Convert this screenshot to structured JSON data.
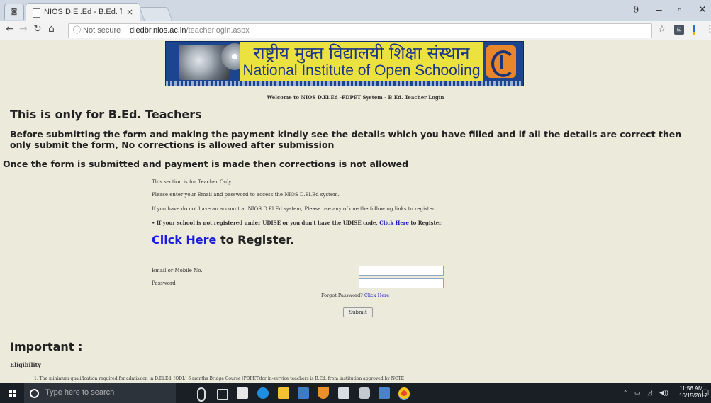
{
  "browser": {
    "tab_title": "NIOS D.El.Ed - B.Ed. Tea",
    "tab_close": "×",
    "security_label": "ⓘ Not secure",
    "url_host": "dledbr.nios.ac.in",
    "url_path": "/teacherlogin.aspx"
  },
  "banner": {
    "hindi_text": "राष्ट्रीय मुक्त विद्यालयी शिक्षा संस्थान",
    "english_text": "National Institute of Open Schooling"
  },
  "page": {
    "welcome": "Welcome to NIOS D.El.Ed -PDPET System - B.Ed. Teacher Login",
    "heading": "This is only for B.Ed. Teachers",
    "notice1": "Before submitting the form and making the payment kindly see the details which you have filled and if all the details are correct then only submit the form, No corrections is allowed after submission",
    "notice2": "Once the form is submitted and payment is made then corrections is not allowed",
    "line1": "This section is for Teacher Only.",
    "line2": "Please enter your Email and password to access the NIOS D.El.Ed system.",
    "line3": "If you have do not have an account at NIOS D.El.Ed system, Please use any of one the following links to register",
    "udise_text_before": "• If your school is not registered under UDISE or you don't have the UDISE code,",
    "udise_link": "Click Here",
    "udise_text_after": "to Register.",
    "register_link": "Click Here",
    "register_text": "to Register."
  },
  "form": {
    "email_label": "Email or Mobile No.",
    "email_value": "",
    "password_label": "Password",
    "password_value": "",
    "forgot_text": "Forgot Password?",
    "forgot_link": "Click Here",
    "submit_label": "Submit"
  },
  "important": {
    "heading": "Important :",
    "eligibility_heading": "Eligibility",
    "point1": "1. The minimum qualification required for admission in D.El.Ed. (ODL) 6 months Bridge Course (PDPET)for in-service teachers is B.Ed. from institution approved by NCTE"
  },
  "taskbar": {
    "search_placeholder": "Type here to search",
    "time": "11:56 AM",
    "date": "10/15/2017"
  },
  "colors": {
    "page_bg": "#eceadb",
    "link": "#1a1ae0",
    "banner_blue": "#1c4590",
    "banner_yellow": "#ece23f"
  }
}
